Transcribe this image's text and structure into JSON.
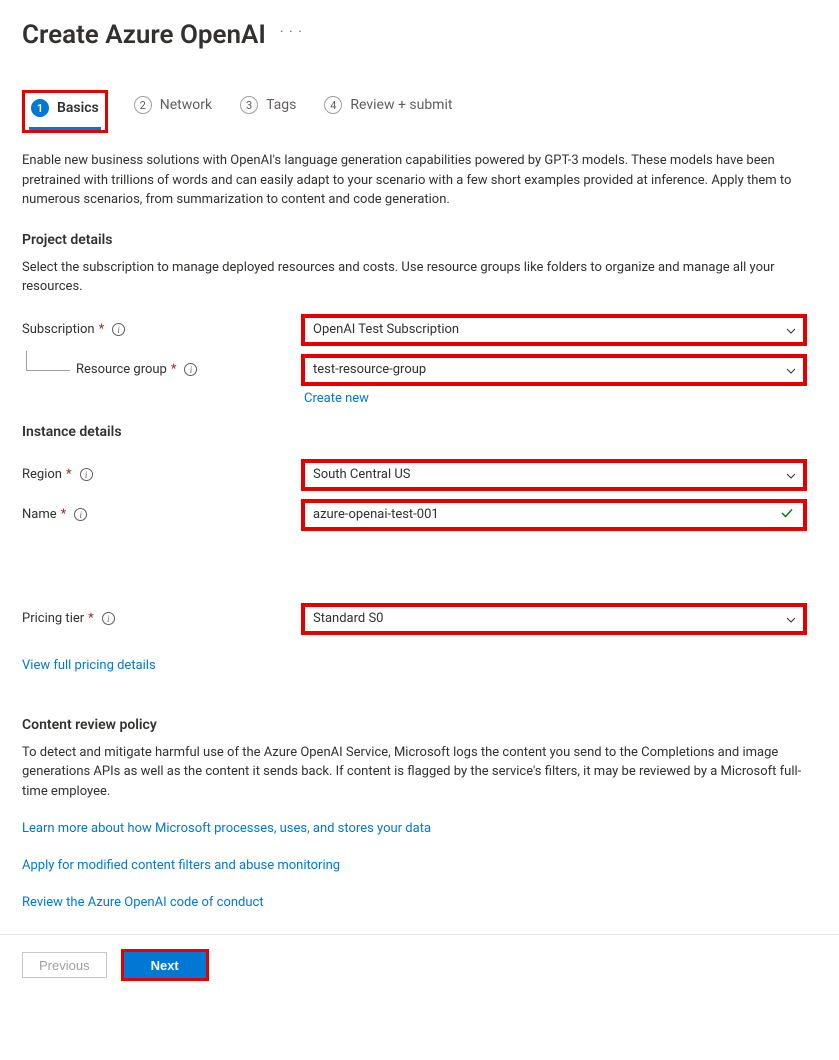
{
  "header": {
    "title": "Create Azure OpenAI"
  },
  "tabs": {
    "t1": {
      "num": "1",
      "label": "Basics"
    },
    "t2": {
      "num": "2",
      "label": "Network"
    },
    "t3": {
      "num": "3",
      "label": "Tags"
    },
    "t4": {
      "num": "4",
      "label": "Review + submit"
    }
  },
  "intro": "Enable new business solutions with OpenAI's language generation capabilities powered by GPT-3 models. These models have been pretrained with trillions of words and can easily adapt to your scenario with a few short examples provided at inference. Apply them to numerous scenarios, from summarization to content and code generation.",
  "project": {
    "title": "Project details",
    "desc": "Select the subscription to manage deployed resources and costs. Use resource groups like folders to organize and manage all your resources.",
    "subscription_label": "Subscription",
    "subscription_value": "OpenAI Test Subscription",
    "resource_group_label": "Resource group",
    "resource_group_value": "test-resource-group",
    "create_new": "Create new"
  },
  "instance": {
    "title": "Instance details",
    "region_label": "Region",
    "region_value": "South Central US",
    "name_label": "Name",
    "name_value": "azure-openai-test-001"
  },
  "pricing": {
    "tier_label": "Pricing tier",
    "tier_value": "Standard S0",
    "link": "View full pricing details"
  },
  "policy": {
    "title": "Content review policy",
    "desc": "To detect and mitigate harmful use of the Azure OpenAI Service, Microsoft logs the content you send to the Completions and image generations APIs as well as the content it sends back. If content is flagged by the service's filters, it may be reviewed by a Microsoft full-time employee.",
    "link1": "Learn more about how Microsoft processes, uses, and stores your data",
    "link2": "Apply for modified content filters and abuse monitoring",
    "link3": "Review the Azure OpenAI code of conduct"
  },
  "footer": {
    "previous": "Previous",
    "next": "Next"
  }
}
